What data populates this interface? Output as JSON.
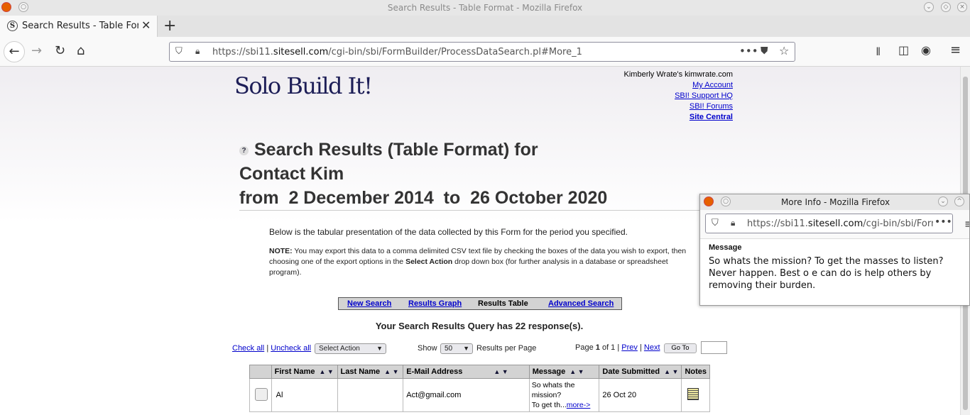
{
  "window": {
    "title": "Search Results - Table Format - Mozilla Firefox",
    "tab_label": "Search Results - Table Format",
    "url_prefix": "https://sbi11.",
    "url_domain": "sitesell.com",
    "url_rest": "/cgi-bin/sbi/FormBuilder/ProcessDataSearch.pl#More_1"
  },
  "header": {
    "logo": "Solo Build It!",
    "user": "Kimberly Wrate's kimwrate.com",
    "links": [
      "My Account",
      "SBI! Support HQ",
      "SBI! Forums"
    ],
    "site_central": "Site Central"
  },
  "page": {
    "title_line1": "Search Results (Table Format) for",
    "title_line2": "Contact Kim",
    "title_line3": "from  2 December 2014  to  26 October 2020",
    "help_icon": "?",
    "description": "Below is the tabular presentation of the data collected by this Form for the period you specified.",
    "note_label": "NOTE:",
    "note_text_1": " You may export this data to a comma delimited CSV text file by checking the boxes of the data you wish to export, then choosing one of the export options in the ",
    "note_bold": "Select Action",
    "note_text_2": " drop down box (for further analysis in a database or spreadsheet program).",
    "tabs": [
      "New Search",
      "Results Graph",
      "Results Table",
      "Advanced Search"
    ],
    "response_count": "Your Search Results Query has 22 response(s)."
  },
  "controls": {
    "check_all": "Check all",
    "separator": "|",
    "uncheck_all": "Uncheck all",
    "select_action": "Select Action",
    "show_label": "Show",
    "per_page": "50",
    "results_per_page": "Results per Page",
    "page_label": "Page",
    "page_num": "1",
    "page_of": "of 1 |",
    "prev": "Prev",
    "next": "Next",
    "go_to": "Go To"
  },
  "table": {
    "headers": [
      "First Name",
      "Last Name",
      "E-Mail Address",
      "Message",
      "Date Submitted",
      "Notes"
    ],
    "sort_arrows": "▲ ▼",
    "row1": {
      "first": "Al",
      "last": "",
      "email": "Act@gmail.com",
      "message_1": "So whats the",
      "message_2": "mission?",
      "message_3": "To get th...",
      "more": "more->",
      "date": "26 Oct 20"
    }
  },
  "popup": {
    "title": "More Info - Mozilla Firefox",
    "url_prefix": "https://sbi11.",
    "url_domain": "sitesell.com",
    "url_rest": "/cgi-bin/sbi/FormBuilder/",
    "label": "Message",
    "message": "So whats the mission? To get the masses to listen? Never happen. Best o e can do is help others by removing their burden."
  }
}
